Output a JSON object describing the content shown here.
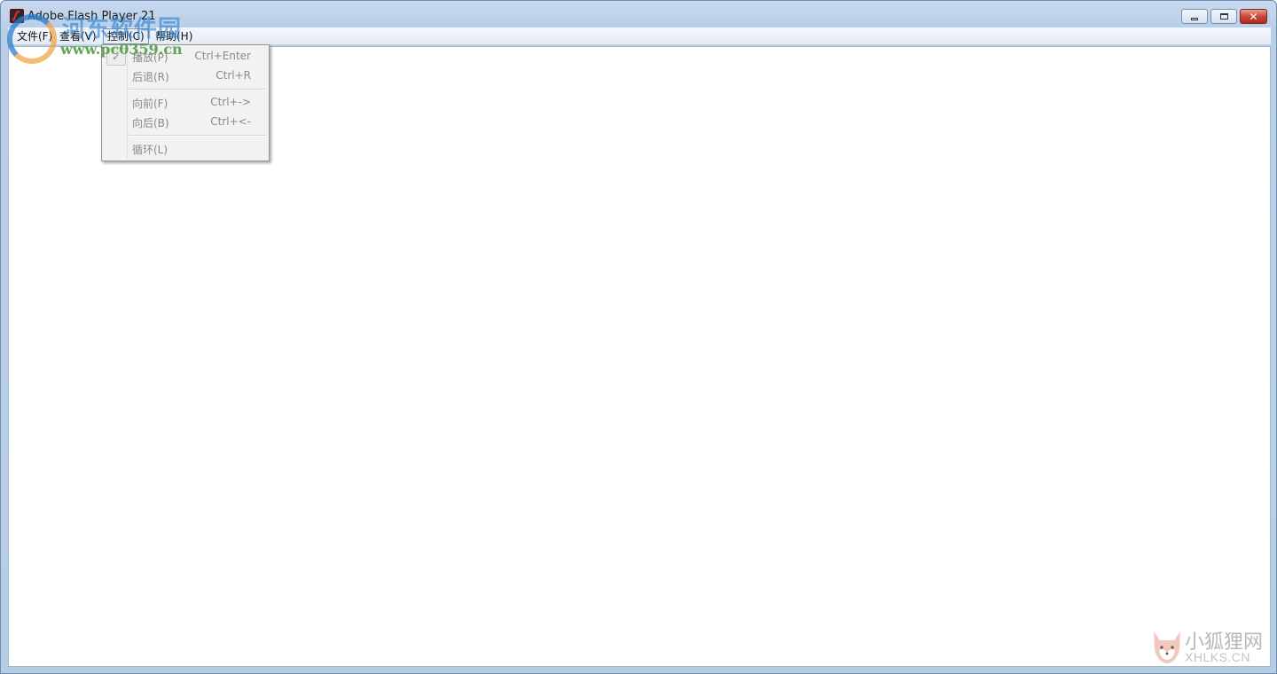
{
  "window": {
    "title": "Adobe Flash Player 21",
    "buttons": {
      "minimize": "minimize-icon",
      "maximize": "maximize-icon",
      "close": "✕"
    }
  },
  "menubar": {
    "items": [
      {
        "label": "文件(F)"
      },
      {
        "label": "查看(V)"
      },
      {
        "label": "控制(C)"
      },
      {
        "label": "帮助(H)"
      }
    ],
    "active_index": 2
  },
  "dropdown": {
    "items": [
      {
        "label": "播放(P)",
        "shortcut": "Ctrl+Enter",
        "checked": true
      },
      {
        "label": "后退(R)",
        "shortcut": "Ctrl+R"
      },
      {
        "label": "向前(F)",
        "shortcut": "Ctrl+->"
      },
      {
        "label": "向后(B)",
        "shortcut": "Ctrl+<-"
      },
      {
        "label": "循环(L)",
        "shortcut": ""
      }
    ],
    "check_mark": "✓"
  },
  "watermarks": {
    "top_left": {
      "name": "河东软件园",
      "url": "www.pc0359.cn"
    },
    "bottom_right": {
      "name": "小狐狸网",
      "url": "XHLKS.CN"
    }
  },
  "colors": {
    "accent": "#2b7dcd",
    "close_button": "#c8483a",
    "menu_text_disabled": "#8a8a8a"
  }
}
